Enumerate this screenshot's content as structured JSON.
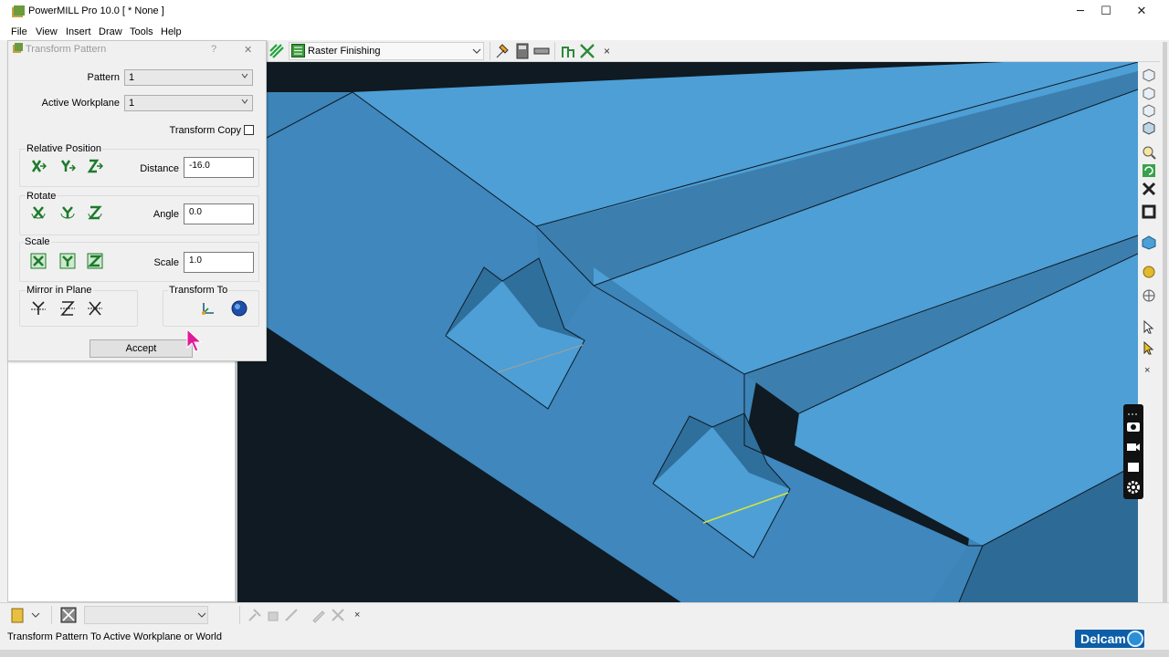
{
  "window": {
    "title": "PowerMILL Pro 10.0     [  * None ]",
    "minimize": "─",
    "maximize": "☐",
    "close": "✕"
  },
  "menu": [
    "File",
    "View",
    "Insert",
    "Draw",
    "Tools",
    "Help"
  ],
  "toolbar": {
    "strategy": "Raster Finishing",
    "close_x": "×"
  },
  "dialog": {
    "title": "Transform Pattern",
    "help": "?",
    "close": "✕",
    "pattern_label": "Pattern",
    "pattern_value": "1",
    "workplane_label": "Active Workplane",
    "workplane_value": "1",
    "transform_copy_label": "Transform Copy",
    "relative_position_label": "Relative Position",
    "distance_label": "Distance",
    "distance_value": "-16.0",
    "rotate_label": "Rotate",
    "angle_label": "Angle",
    "angle_value": "0.0",
    "scale_group_label": "Scale",
    "scale_label": "Scale",
    "scale_value": "1.0",
    "mirror_label": "Mirror in Plane",
    "transform_to_label": "Transform To",
    "accept_label": "Accept"
  },
  "right_toolbar": {
    "close_x": "×"
  },
  "bottom_toolbar": {
    "close_x": "×"
  },
  "status": {
    "text": "Transform Pattern To Active Workplane or World",
    "brand": "Delcam"
  },
  "colors": {
    "model_top": "#4d9fd6",
    "model_side": "#3f87bc",
    "model_dark": "#2e6a96",
    "background": "#1a2530",
    "toolpath_yellow": "#d6e43a"
  }
}
